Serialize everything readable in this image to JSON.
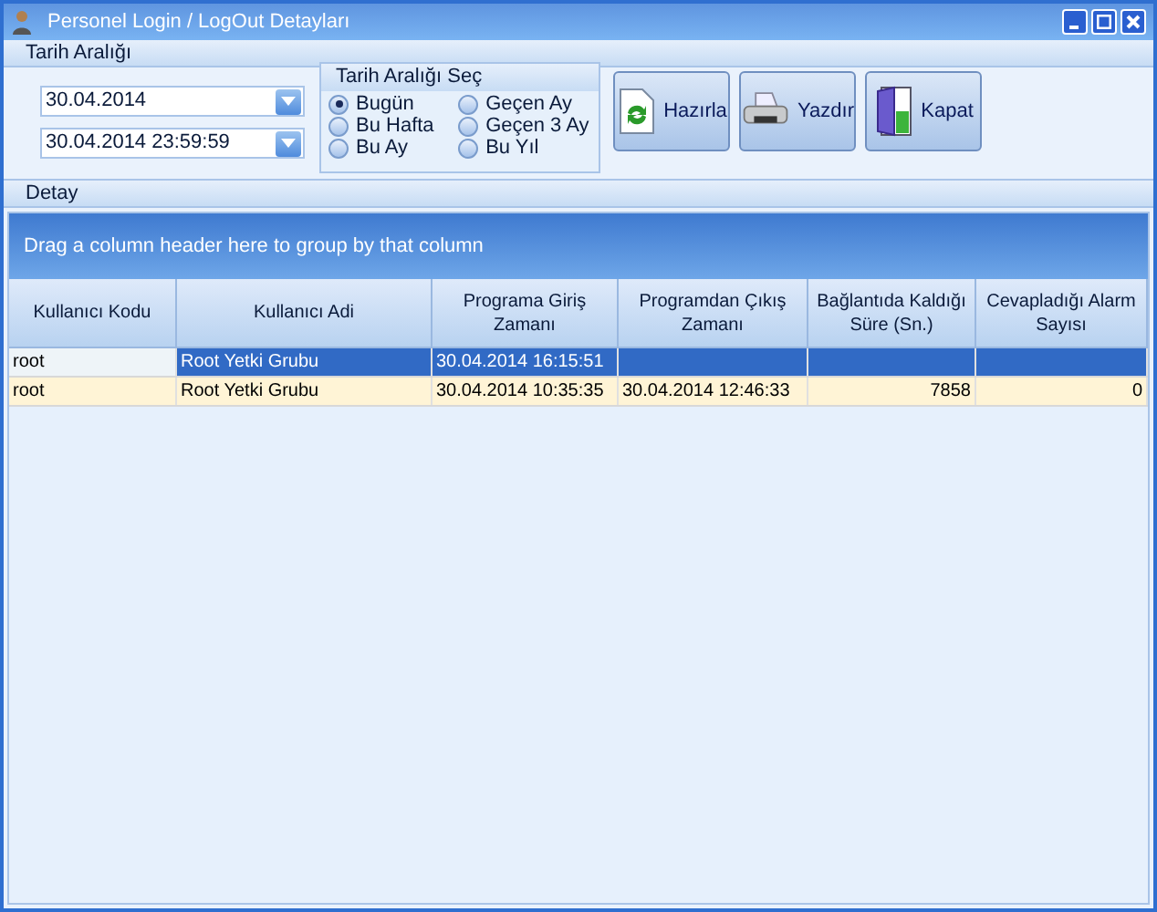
{
  "window": {
    "title": "Personel Login / LogOut Detayları"
  },
  "date_range": {
    "title": "Tarih Aralığı",
    "start": "30.04.2014",
    "end": "30.04.2014 23:59:59"
  },
  "range_select": {
    "title": "Tarih Aralığı Seç",
    "options": [
      {
        "label": "Bugün",
        "selected": true
      },
      {
        "label": "Bu Hafta",
        "selected": false
      },
      {
        "label": "Bu Ay",
        "selected": false
      },
      {
        "label": "Geçen Ay",
        "selected": false
      },
      {
        "label": "Geçen 3 Ay",
        "selected": false
      },
      {
        "label": "Bu Yıl",
        "selected": false
      }
    ]
  },
  "buttons": [
    {
      "label": "Hazırla",
      "kind": "refresh"
    },
    {
      "label": "Yazdır",
      "kind": "print"
    },
    {
      "label": "Kapat",
      "kind": "exit"
    }
  ],
  "detail": {
    "title": "Detay",
    "group_hint": "Drag a column header here to group by that column",
    "columns": [
      "Kullanıcı Kodu",
      "Kullanıcı Adi",
      "Programa Giriş Zamanı",
      "Programdan Çıkış Zamanı",
      "Bağlantıda Kaldığı Süre (Sn.)",
      "Cevapladığı Alarm Sayısı"
    ],
    "rows": [
      {
        "selected": true,
        "cells": [
          "root",
          "Root Yetki Grubu",
          "30.04.2014 16:15:51",
          "",
          "",
          ""
        ]
      },
      {
        "selected": false,
        "cells": [
          "root",
          "Root Yetki Grubu",
          "30.04.2014 10:35:35",
          "30.04.2014 12:46:33",
          "7858",
          "0"
        ]
      }
    ]
  }
}
